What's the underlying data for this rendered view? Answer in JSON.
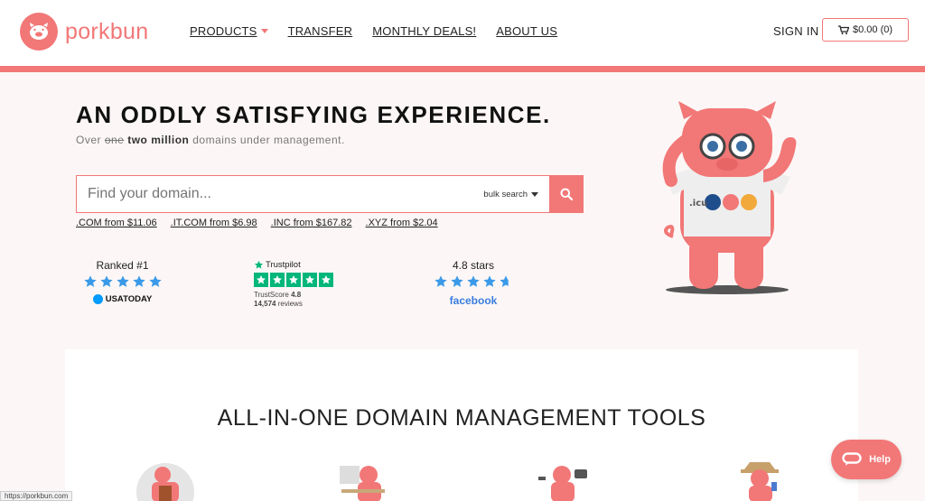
{
  "brand": {
    "name": "porkbun"
  },
  "nav": {
    "products": "PRODUCTS",
    "transfer": "TRANSFER",
    "deals": "MONTHLY DEALS!",
    "about": "ABOUT US",
    "signin": "SIGN IN",
    "cart": "$0.00 (0)"
  },
  "hero": {
    "headline": "AN ODDLY SATISFYING EXPERIENCE.",
    "sub_prefix": "Over ",
    "sub_strike": "one",
    "sub_bold": "two million",
    "sub_suffix": " domains under management.",
    "search_placeholder": "Find your domain...",
    "bulk_search": "bulk search",
    "mascot_tld": ".icu",
    "tld_prices": [
      ".COM from $11.06",
      ".IT.COM from $6.98",
      ".INC from $167.82",
      ".XYZ from $2.04"
    ]
  },
  "ratings": {
    "usa": {
      "title": "Ranked #1",
      "brand": "USATODAY",
      "stars": 5
    },
    "trustpilot": {
      "brand": "Trustpilot",
      "score_label": "TrustScore",
      "score": "4.8",
      "reviews": "14,574",
      "reviews_label": "reviews",
      "stars": 5
    },
    "facebook": {
      "title": "4.8 stars",
      "brand": "facebook",
      "stars": 4.8
    }
  },
  "tools": {
    "title": "ALL-IN-ONE DOMAIN MANAGEMENT TOOLS"
  },
  "status_url": "https://porkbun.com",
  "help": {
    "label": "Help"
  },
  "colors": {
    "brand": "#f27777",
    "hero_bg": "#fcf7f6",
    "star_blue": "#3b9ae8",
    "trustpilot": "#00b67a",
    "facebook": "#3b7de0"
  }
}
